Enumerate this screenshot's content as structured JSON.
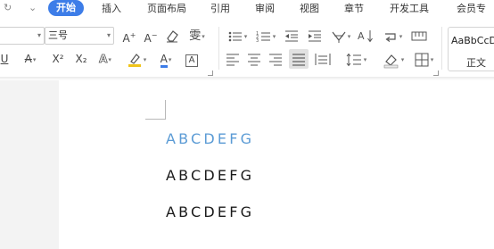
{
  "menubar": {
    "tabs": [
      {
        "label": "开始",
        "active": true
      },
      {
        "label": "插入"
      },
      {
        "label": "页面布局"
      },
      {
        "label": "引用"
      },
      {
        "label": "审阅"
      },
      {
        "label": "视图"
      },
      {
        "label": "章节"
      },
      {
        "label": "开发工具"
      },
      {
        "label": "会员专"
      }
    ],
    "icons": [
      "redo-icon",
      "menu-dropdown-icon"
    ]
  },
  "ribbon": {
    "font_name_value": "",
    "font_size_value": "三号",
    "superscript": "X²",
    "subscript": "X₂",
    "style_sample": "AaBbCcD",
    "style_name": "正文"
  },
  "document": {
    "lines": [
      {
        "text": "ABCDEFG",
        "color": "#5b9bd5"
      },
      {
        "text": "ABCDEFG",
        "color": "#1a1a1a"
      },
      {
        "text": "ABCDEFG",
        "color": "#1a1a1a"
      }
    ]
  },
  "colors": {
    "accent": "#3d7de8",
    "font_color_bar": "#3d7de8",
    "highlight_bar": "#f0c419"
  }
}
